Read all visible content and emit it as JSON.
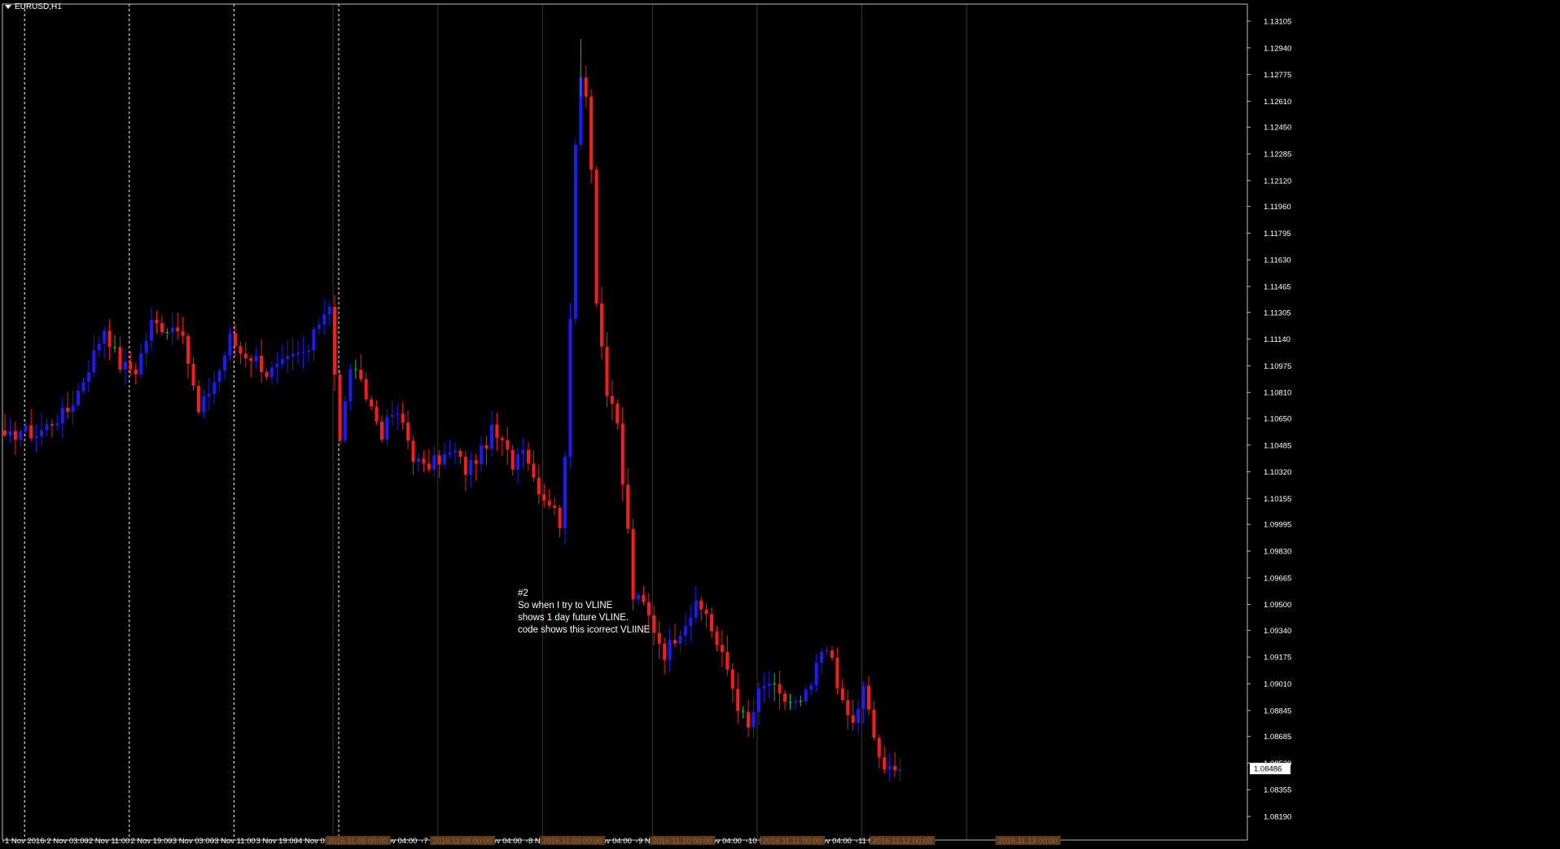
{
  "symbol_label": "EURUSD,H1",
  "annotation": [
    "#2",
    "So when I try to VLINE",
    "shows 1 day future VLINE.",
    "code shows this icorrect VLIINE"
  ],
  "colors": {
    "background": "#000000",
    "axis": "#c0c0c0",
    "text": "#ffffff",
    "bull": "#1a1aff",
    "bear": "#ff1a1a",
    "doji": "#19c819",
    "period_separator": "#4a3018",
    "vline_white": "#ffffff",
    "date_label_bg": "#5c3a1c",
    "date_label_text": "#a06030",
    "current_price_bg": "#ffffff",
    "current_price_text": "#000000"
  },
  "chart_data": {
    "type": "candlestick",
    "symbol": "EURUSD",
    "timeframe": "H1",
    "ylim": [
      1.0819,
      1.13105
    ],
    "y_ticks": [
      1.13105,
      1.1294,
      1.12775,
      1.1261,
      1.1245,
      1.12285,
      1.1212,
      1.1196,
      1.11795,
      1.1163,
      1.11465,
      1.11305,
      1.1114,
      1.10975,
      1.1081,
      1.1065,
      1.10485,
      1.1032,
      1.10155,
      1.09995,
      1.0983,
      1.09665,
      1.095,
      1.0934,
      1.09175,
      1.0901,
      1.08845,
      1.08685,
      1.0852,
      1.08355,
      1.0819
    ],
    "y_tick_labels": [
      "1.13105",
      "1.12940",
      "1.12775",
      "1.12610",
      "1.12450",
      "1.12285",
      "1.12120",
      "1.11960",
      "1.11795",
      "1.11630",
      "1.11465",
      "1.11305",
      "1.11140",
      "1.10975",
      "1.10810",
      "1.10650",
      "1.10485",
      "1.10320",
      "1.10155",
      "1.09995",
      "1.09830",
      "1.09665",
      "1.09500",
      "1.09340",
      "1.09175",
      "1.09010",
      "1.08845",
      "1.08685",
      "1.08520",
      "1.08355",
      "1.08190"
    ],
    "current_price": 1.08486,
    "current_price_label": "1.08486",
    "bar_count": 207,
    "x_labels": [
      {
        "bar": 0,
        "text": "1 Nov 2016"
      },
      {
        "bar": 8,
        "text": "2 Nov 03:00"
      },
      {
        "bar": 16,
        "text": "2 Nov 11:00"
      },
      {
        "bar": 24,
        "text": "2 Nov 19:00"
      },
      {
        "bar": 32,
        "text": "3 Nov 03:00"
      },
      {
        "bar": 40,
        "text": "3 Nov 11:00"
      },
      {
        "bar": 48,
        "text": "3 Nov 19:00"
      },
      {
        "bar": 56,
        "text": "4 Nov 03:00"
      },
      {
        "bar": 64,
        "text": "4 Nov 11:00"
      },
      {
        "bar": 72,
        "text": "Nov 04:00"
      },
      {
        "bar": 80,
        "text": "7 Nov 12:00"
      },
      {
        "bar": 92,
        "text": "Nov 04:00"
      },
      {
        "bar": 100,
        "text": "8 Nov 12:00"
      },
      {
        "bar": 113,
        "text": "Nov 04:00"
      },
      {
        "bar": 121,
        "text": "9 Nov 12:00"
      },
      {
        "bar": 134,
        "text": "Nov 04:00"
      },
      {
        "bar": 142,
        "text": "10 Nov 12:00"
      },
      {
        "bar": 155,
        "text": "Nov 04:00"
      },
      {
        "bar": 163,
        "text": "11 Nov 12:00"
      }
    ],
    "date_labels": [
      {
        "bar": 62,
        "text": "2016.11.05 00:00"
      },
      {
        "bar": 82,
        "text": "2016.11.08 00:00"
      },
      {
        "bar": 103,
        "text": "2016.11.09 00:00"
      },
      {
        "bar": 124,
        "text": "2016.11.10 00:00"
      },
      {
        "bar": 145,
        "text": "2016.11.11 00:00"
      },
      {
        "bar": 166,
        "text": "2016.11.12 00:00"
      },
      {
        "bar": 190,
        "text": "2016.11.13 00:00"
      }
    ],
    "vlines_white": [
      4,
      24,
      44,
      64
    ],
    "period_separators": [
      63,
      83,
      103,
      124,
      144,
      164,
      184
    ],
    "anchors": [
      {
        "bar": 0,
        "close": 1.1051
      },
      {
        "bar": 3,
        "close": 1.1058
      },
      {
        "bar": 6,
        "close": 1.1055
      },
      {
        "bar": 9,
        "close": 1.1063
      },
      {
        "bar": 12,
        "close": 1.107
      },
      {
        "bar": 14,
        "close": 1.1082
      },
      {
        "bar": 16,
        "close": 1.1097
      },
      {
        "bar": 19,
        "close": 1.1121
      },
      {
        "bar": 22,
        "close": 1.1098
      },
      {
        "bar": 25,
        "close": 1.1095
      },
      {
        "bar": 28,
        "close": 1.1124
      },
      {
        "bar": 31,
        "close": 1.1121
      },
      {
        "bar": 33,
        "close": 1.1123
      },
      {
        "bar": 35,
        "close": 1.11
      },
      {
        "bar": 37,
        "close": 1.1068
      },
      {
        "bar": 39,
        "close": 1.1082
      },
      {
        "bar": 41,
        "close": 1.1095
      },
      {
        "bar": 43,
        "close": 1.1115
      },
      {
        "bar": 45,
        "close": 1.1106
      },
      {
        "bar": 48,
        "close": 1.1102
      },
      {
        "bar": 50,
        "close": 1.1093
      },
      {
        "bar": 52,
        "close": 1.1096
      },
      {
        "bar": 55,
        "close": 1.1102
      },
      {
        "bar": 58,
        "close": 1.1107
      },
      {
        "bar": 60,
        "close": 1.1125
      },
      {
        "bar": 62,
        "close": 1.1137
      },
      {
        "bar": 64,
        "close": 1.105
      },
      {
        "bar": 66,
        "close": 1.1098
      },
      {
        "bar": 68,
        "close": 1.1085
      },
      {
        "bar": 70,
        "close": 1.1072
      },
      {
        "bar": 72,
        "close": 1.1056
      },
      {
        "bar": 74,
        "close": 1.1068
      },
      {
        "bar": 76,
        "close": 1.1062
      },
      {
        "bar": 78,
        "close": 1.1042
      },
      {
        "bar": 80,
        "close": 1.1034
      },
      {
        "bar": 83,
        "close": 1.104
      },
      {
        "bar": 86,
        "close": 1.1044
      },
      {
        "bar": 88,
        "close": 1.1033
      },
      {
        "bar": 91,
        "close": 1.1044
      },
      {
        "bar": 93,
        "close": 1.1057
      },
      {
        "bar": 95,
        "close": 1.1049
      },
      {
        "bar": 97,
        "close": 1.1037
      },
      {
        "bar": 99,
        "close": 1.105
      },
      {
        "bar": 101,
        "close": 1.1029
      },
      {
        "bar": 103,
        "close": 1.1016
      },
      {
        "bar": 105,
        "close": 1.1012
      },
      {
        "bar": 106,
        "close": 1.0995
      },
      {
        "bar": 107,
        "close": 1.1045
      },
      {
        "bar": 108,
        "close": 1.113
      },
      {
        "bar": 109,
        "close": 1.123
      },
      {
        "bar": 110,
        "close": 1.1275
      },
      {
        "bar": 111,
        "close": 1.1268
      },
      {
        "bar": 112,
        "close": 1.122
      },
      {
        "bar": 113,
        "close": 1.114
      },
      {
        "bar": 115,
        "close": 1.108
      },
      {
        "bar": 117,
        "close": 1.106
      },
      {
        "bar": 118,
        "close": 1.1025
      },
      {
        "bar": 119,
        "close": 1.0995
      },
      {
        "bar": 120,
        "close": 1.0955
      },
      {
        "bar": 122,
        "close": 1.095
      },
      {
        "bar": 124,
        "close": 1.0935
      },
      {
        "bar": 126,
        "close": 1.092
      },
      {
        "bar": 128,
        "close": 1.093
      },
      {
        "bar": 130,
        "close": 1.094
      },
      {
        "bar": 132,
        "close": 1.0948
      },
      {
        "bar": 134,
        "close": 1.0945
      },
      {
        "bar": 136,
        "close": 1.0925
      },
      {
        "bar": 138,
        "close": 1.091
      },
      {
        "bar": 140,
        "close": 1.0888
      },
      {
        "bar": 142,
        "close": 1.0873
      },
      {
        "bar": 144,
        "close": 1.0895
      },
      {
        "bar": 146,
        "close": 1.0902
      },
      {
        "bar": 148,
        "close": 1.0892
      },
      {
        "bar": 150,
        "close": 1.089
      },
      {
        "bar": 152,
        "close": 1.0888
      },
      {
        "bar": 154,
        "close": 1.09
      },
      {
        "bar": 156,
        "close": 1.092
      },
      {
        "bar": 158,
        "close": 1.0918
      },
      {
        "bar": 160,
        "close": 1.0887
      },
      {
        "bar": 162,
        "close": 1.0876
      },
      {
        "bar": 164,
        "close": 1.0898
      },
      {
        "bar": 166,
        "close": 1.0868
      },
      {
        "bar": 168,
        "close": 1.0845
      },
      {
        "bar": 170,
        "close": 1.0852
      },
      {
        "bar": 172,
        "close": 1.0848
      }
    ]
  }
}
